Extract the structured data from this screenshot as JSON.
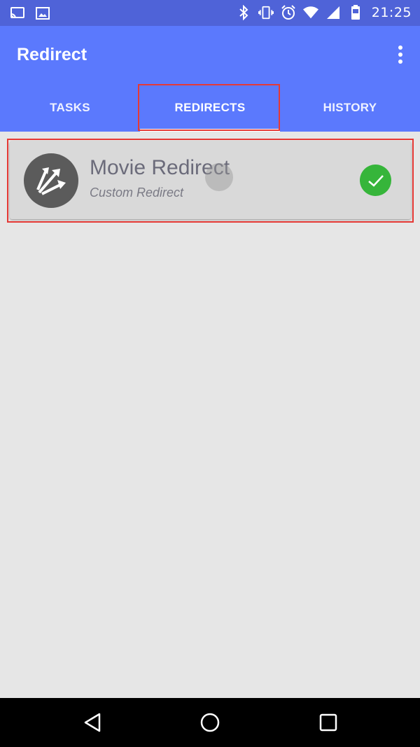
{
  "status_bar": {
    "time": "21:25",
    "left_icons": [
      "cast-icon",
      "image-icon"
    ],
    "right_icons": [
      "bluetooth-icon",
      "vibrate-icon",
      "alarm-icon",
      "wifi-icon",
      "signal-icon",
      "battery-icon"
    ]
  },
  "app_bar": {
    "title": "Redirect",
    "overflow_icon": "more-vert-icon",
    "background": "#5b79fd"
  },
  "tabs": [
    {
      "label": "TASKS",
      "active": false
    },
    {
      "label": "REDIRECTS",
      "active": true
    },
    {
      "label": "HISTORY",
      "active": false
    }
  ],
  "redirects": [
    {
      "title": "Movie Redirect",
      "subtitle": "Custom Redirect",
      "icon": "redirect-arrows-icon",
      "status_icon": "check-icon",
      "status_color": "#36b53a"
    }
  ],
  "nav_bar": {
    "icons": [
      "back-icon",
      "home-icon",
      "recents-icon"
    ]
  },
  "highlight_color": "#e53935"
}
